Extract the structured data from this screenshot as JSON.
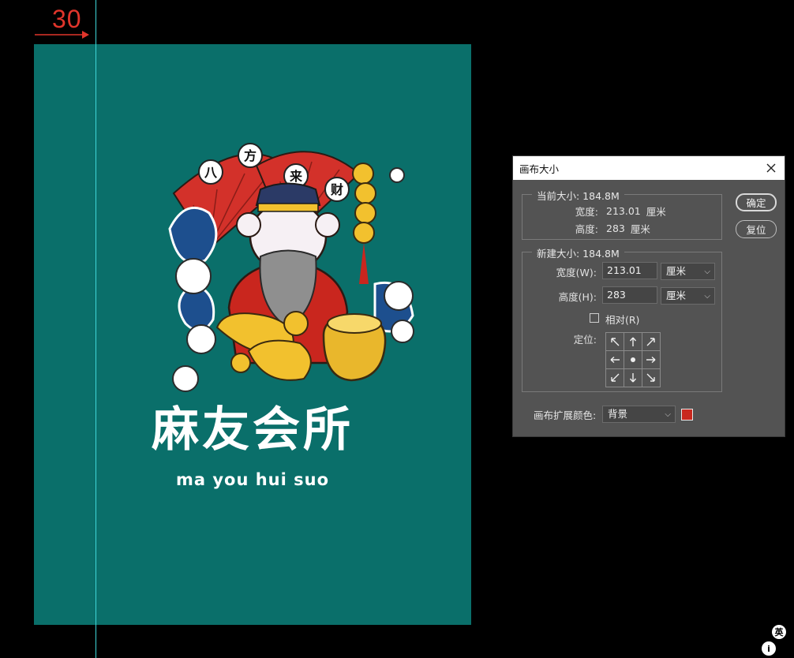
{
  "annotation": {
    "guide_offset_label": "30"
  },
  "artwork": {
    "title": "麻友会所",
    "subtitle": "ma you hui suo",
    "fan_chars": [
      "八",
      "方",
      "来",
      "财"
    ]
  },
  "dialog": {
    "title": "画布大小",
    "current": {
      "legend": "当前大小: 184.8M",
      "width_label": "宽度:",
      "width_value": "213.01",
      "width_unit": "厘米",
      "height_label": "高度:",
      "height_value": "283",
      "height_unit": "厘米"
    },
    "new": {
      "legend": "新建大小: 184.8M",
      "width_label": "宽度(W):",
      "width_value": "213.01",
      "width_unit": "厘米",
      "height_label": "高度(H):",
      "height_value": "283",
      "height_unit": "厘米",
      "relative_label": "相对(R)",
      "relative_checked": false,
      "anchor_label": "定位:"
    },
    "ok_label": "确定",
    "reset_label": "复位",
    "extension_color_label": "画布扩展颜色:",
    "extension_color_value": "背景",
    "extension_swatch_color": "#c8281e"
  },
  "taskbar": {
    "ime_label": "英"
  },
  "colors": {
    "canvas": "#0a6f6a",
    "guide": "#3fd6d8",
    "annotation": "#e0352b"
  }
}
